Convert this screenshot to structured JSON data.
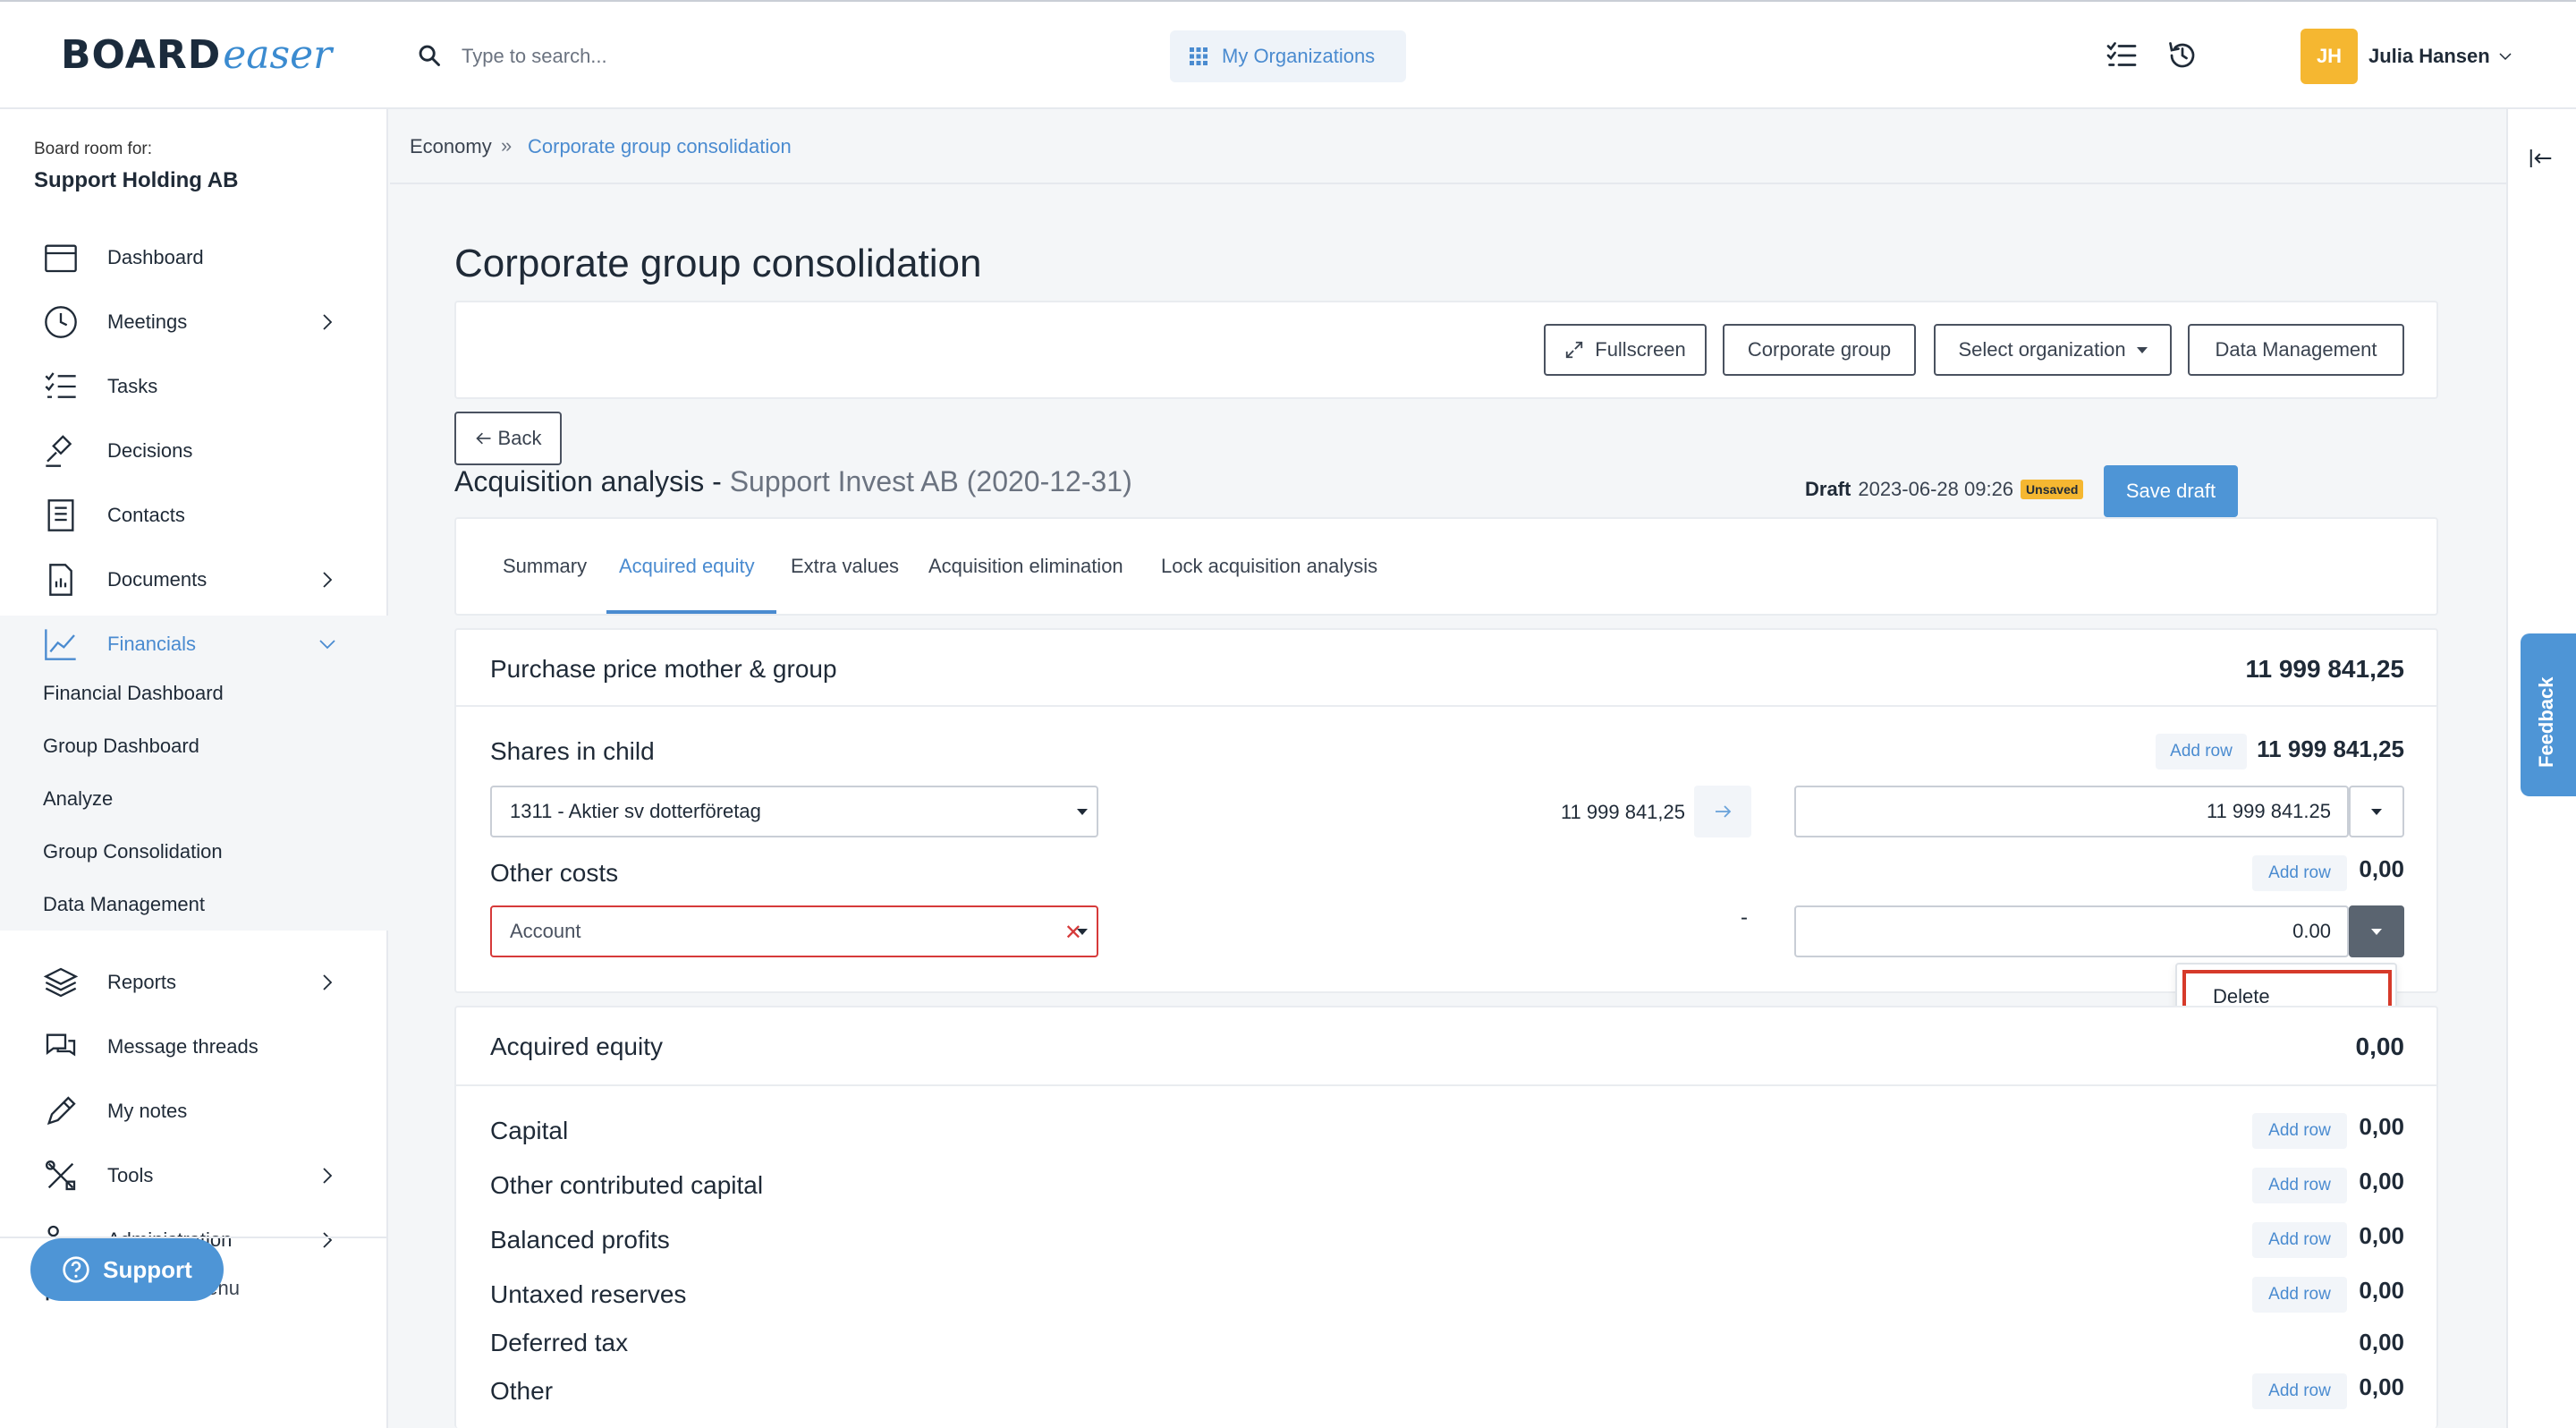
{
  "app": {
    "logo_board": "BOARD",
    "logo_easer": "easer",
    "search_placeholder": "Type to search...",
    "org_button": "My Organizations",
    "user": {
      "initials": "JH",
      "name": "Julia Hansen"
    }
  },
  "sidebar": {
    "board_room_for": "Board room for:",
    "org_name": "Support Holding AB",
    "items": [
      {
        "label": "Dashboard",
        "icon": "calendar-icon"
      },
      {
        "label": "Meetings",
        "icon": "clock-icon"
      },
      {
        "label": "Tasks",
        "icon": "checklist-icon"
      },
      {
        "label": "Decisions",
        "icon": "gavel-icon"
      },
      {
        "label": "Contacts",
        "icon": "address-book-icon"
      },
      {
        "label": "Documents",
        "icon": "document-icon"
      },
      {
        "label": "Financials",
        "icon": "chart-line-icon"
      },
      {
        "label": "Reports",
        "icon": "layers-icon"
      },
      {
        "label": "Message threads",
        "icon": "chat-icon"
      },
      {
        "label": "My notes",
        "icon": "pencil-icon"
      },
      {
        "label": "Tools",
        "icon": "tools-icon"
      },
      {
        "label": "Administration",
        "icon": "users-gear-icon"
      }
    ],
    "financials_sub": [
      "Financial Dashboard",
      "Group Dashboard",
      "Analyze",
      "Group Consolidation",
      "Data Management"
    ],
    "minimize": "Minimize menu",
    "support": "Support"
  },
  "breadcrumb": {
    "parent": "Economy",
    "separator": "»",
    "current": "Corporate group consolidation"
  },
  "page": {
    "title": "Corporate group consolidation",
    "toolbar": {
      "fullscreen": "Fullscreen",
      "corporate_group": "Corporate group",
      "select_org": "Select organization",
      "data_management": "Data Management"
    },
    "back": "Back",
    "analysis_title": "Acquisition analysis - ",
    "analysis_subtitle": "Support Invest AB (2020-12-31)",
    "draft_label": "Draft",
    "draft_timestamp": "2023-06-28 09:26",
    "unsaved_badge": "Unsaved",
    "save_draft": "Save draft",
    "tabs": [
      "Summary",
      "Acquired equity",
      "Extra values",
      "Acquisition elimination",
      "Lock acquisition analysis"
    ],
    "active_tab": "Acquired equity"
  },
  "purchase": {
    "title": "Purchase price mother & group",
    "total": "11 999 841,25",
    "shares_label": "Shares in child",
    "add_row": "Add row",
    "shares_total": "11 999 841,25",
    "shares_account": "1311 - Aktier sv dotterföretag",
    "shares_mid_value": "11 999 841,25",
    "shares_input": "11 999 841.25",
    "other_costs_label": "Other costs",
    "other_costs_total": "0,00",
    "account_placeholder": "Account",
    "other_dash": "-",
    "other_input": "0.00",
    "delete": "Delete"
  },
  "acquired_equity": {
    "title": "Acquired equity",
    "total": "0,00",
    "rows": [
      {
        "label": "Capital",
        "value": "0,00",
        "add_row": "Add row"
      },
      {
        "label": "Other contributed capital",
        "value": "0,00",
        "add_row": "Add row"
      },
      {
        "label": "Balanced profits",
        "value": "0,00",
        "add_row": "Add row"
      },
      {
        "label": "Untaxed reserves",
        "value": "0,00",
        "add_row": "Add row"
      },
      {
        "label": "Deferred tax",
        "value": "0,00",
        "add_row": ""
      },
      {
        "label": "Other",
        "value": "0,00",
        "add_row": "Add row"
      }
    ]
  },
  "feedback": "Feedback",
  "colors": {
    "accent": "#4a8bd0",
    "brand_button": "#4e95d6",
    "error": "#d63a3a",
    "badge": "#f5b731"
  }
}
